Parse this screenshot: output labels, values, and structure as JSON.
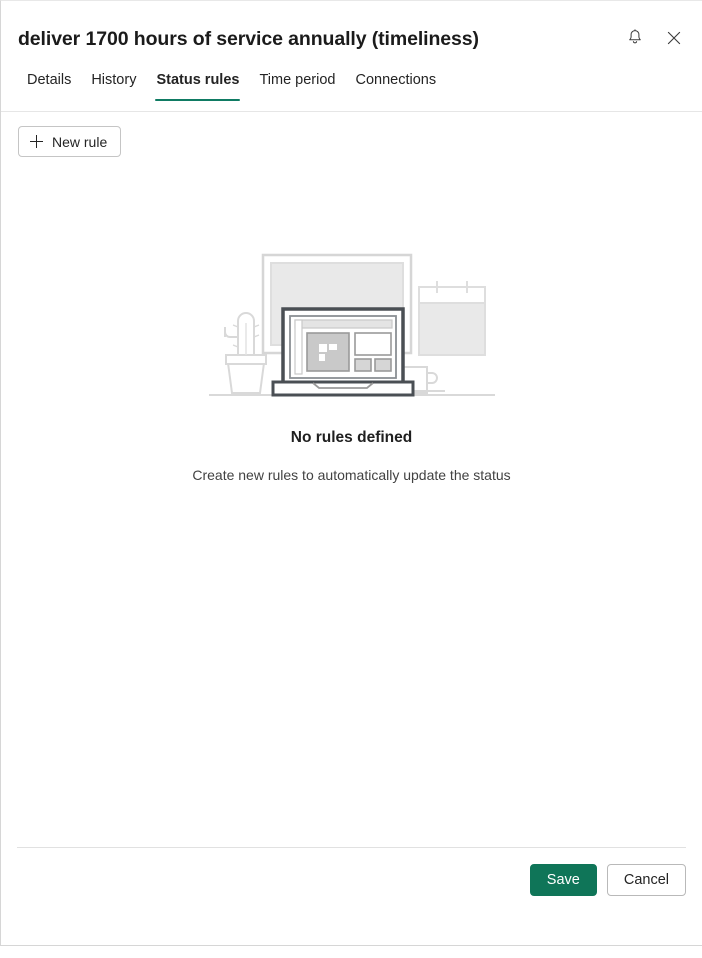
{
  "panel": {
    "title": "deliver 1700 hours of service annually (timeliness)",
    "actions": [
      {
        "name": "notifications-icon",
        "label": "Notifications"
      },
      {
        "name": "close-icon",
        "label": "Close"
      }
    ]
  },
  "tabs": [
    {
      "label": "Details",
      "active": false
    },
    {
      "label": "History",
      "active": false
    },
    {
      "label": "Status rules",
      "active": true
    },
    {
      "label": "Time period",
      "active": false
    },
    {
      "label": "Connections",
      "active": false
    }
  ],
  "toolbar": {
    "new_rule_label": "New rule",
    "new_rule_icon": "plus-icon"
  },
  "empty_state": {
    "illustration": "desk-scene-illustration",
    "title": "No rules defined",
    "subtitle": "Create new rules to automatically update the status"
  },
  "footer": {
    "save_label": "Save",
    "cancel_label": "Cancel"
  },
  "colors": {
    "accent": "#0f7b63",
    "primary_button": "#0f7558",
    "text": "#242424",
    "border": "#e6e6e6",
    "illustration_light": "#d8d8d8",
    "illustration_fill": "#e9e9e9",
    "illustration_dark": "#4a4f54"
  }
}
